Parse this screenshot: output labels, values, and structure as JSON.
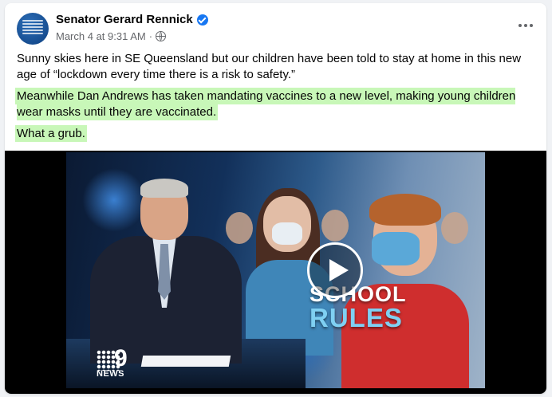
{
  "post": {
    "author": "Senator Gerard Rennick",
    "timestamp": "March 4 at 9:31 AM",
    "separator": "·",
    "paragraphs": [
      "Sunny skies here in SE Queensland but our children have been told to stay at home in this new age of “lockdown every time there is a risk to safety.”",
      "Meanwhile Dan Andrews has taken mandating  vaccines to a new level, making young children wear masks until they are vaccinated.",
      "What a grub."
    ]
  },
  "video": {
    "overlay_line1": "SCHOOL",
    "overlay_line2": "RULES",
    "logo_number": "9",
    "logo_text": "NEWS"
  },
  "colors": {
    "highlight": "#c8f7b8",
    "verified": "#1877f2",
    "overlay_accent": "#7fd0f2"
  },
  "icons": {
    "verified": "verified-badge-icon",
    "audience": "globe-icon",
    "menu": "more-horizontal-icon",
    "play": "play-icon"
  }
}
